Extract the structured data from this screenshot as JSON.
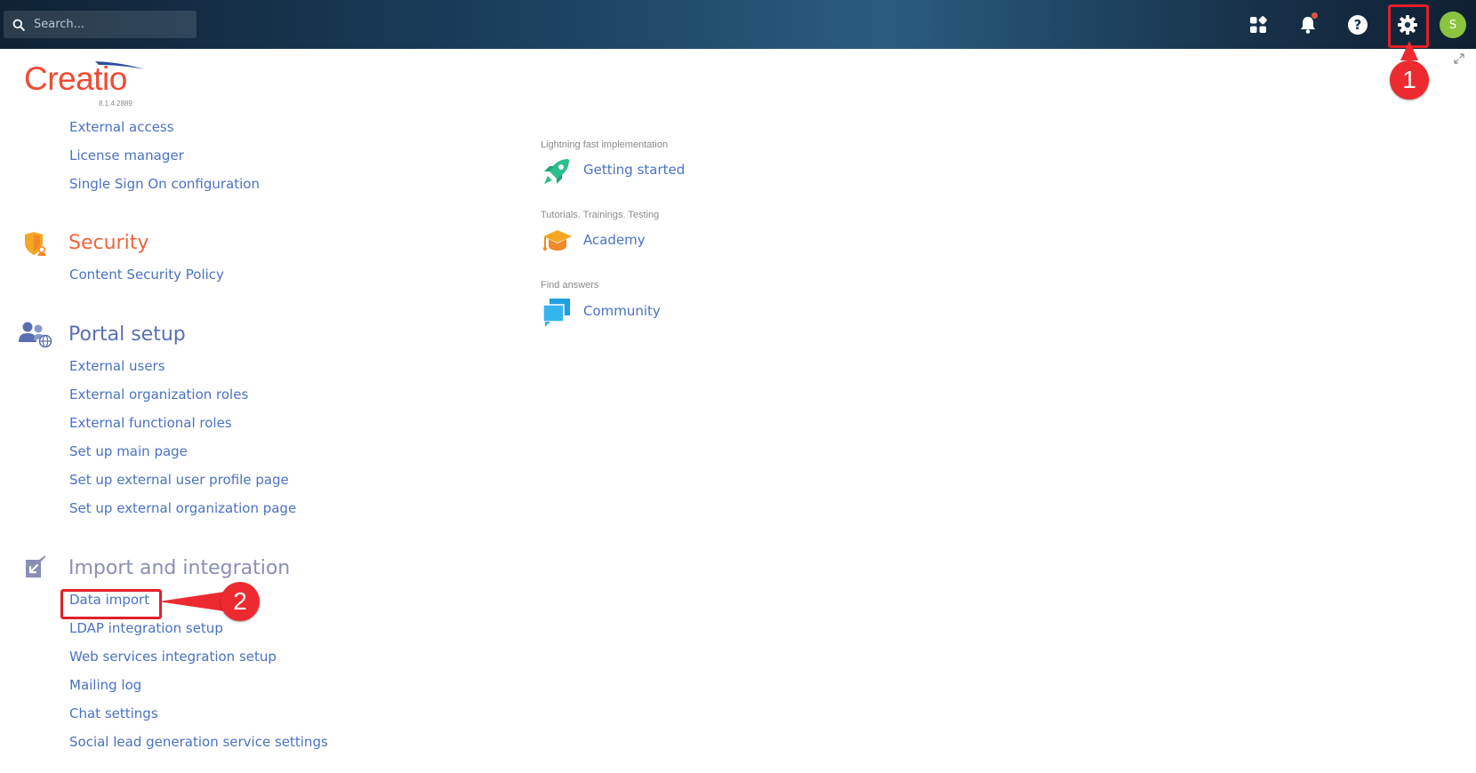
{
  "search": {
    "placeholder": "Search..."
  },
  "header": {
    "avatar_initial": "S",
    "icons": [
      "apps-icon",
      "bell-icon",
      "help-icon",
      "gear-icon"
    ]
  },
  "logo": {
    "text": "Creatio",
    "version": "8.1.4.2889"
  },
  "sections": {
    "access": {
      "links": [
        "External access",
        "License manager",
        "Single Sign On configuration"
      ]
    },
    "security": {
      "title": "Security",
      "color": "#f0643c",
      "links": [
        "Content Security Policy"
      ]
    },
    "portal": {
      "title": "Portal setup",
      "color": "#5a6fb2",
      "links": [
        "External users",
        "External organization roles",
        "External functional roles",
        "Set up main page",
        "Set up external user profile page",
        "Set up external organization page"
      ]
    },
    "import": {
      "title": "Import and integration",
      "color": "#8a8fb5",
      "links": [
        "Data import",
        "LDAP integration setup",
        "Web services integration setup",
        "Mailing log",
        "Chat settings",
        "Social lead generation service settings"
      ]
    }
  },
  "resources": [
    {
      "caption": "Lightning fast implementation",
      "label": "Getting started",
      "icon": "rocket-icon"
    },
    {
      "caption": "Tutorials. Trainings. Testing",
      "label": "Academy",
      "icon": "graduation-cap-icon"
    },
    {
      "caption": "Find answers",
      "label": "Community",
      "icon": "chat-bubbles-icon"
    }
  ],
  "annotations": {
    "step1": "1",
    "step2": "2"
  },
  "colors": {
    "link": "#4a72c2",
    "accent": "#f04a32",
    "highlight": "#e0202a"
  }
}
